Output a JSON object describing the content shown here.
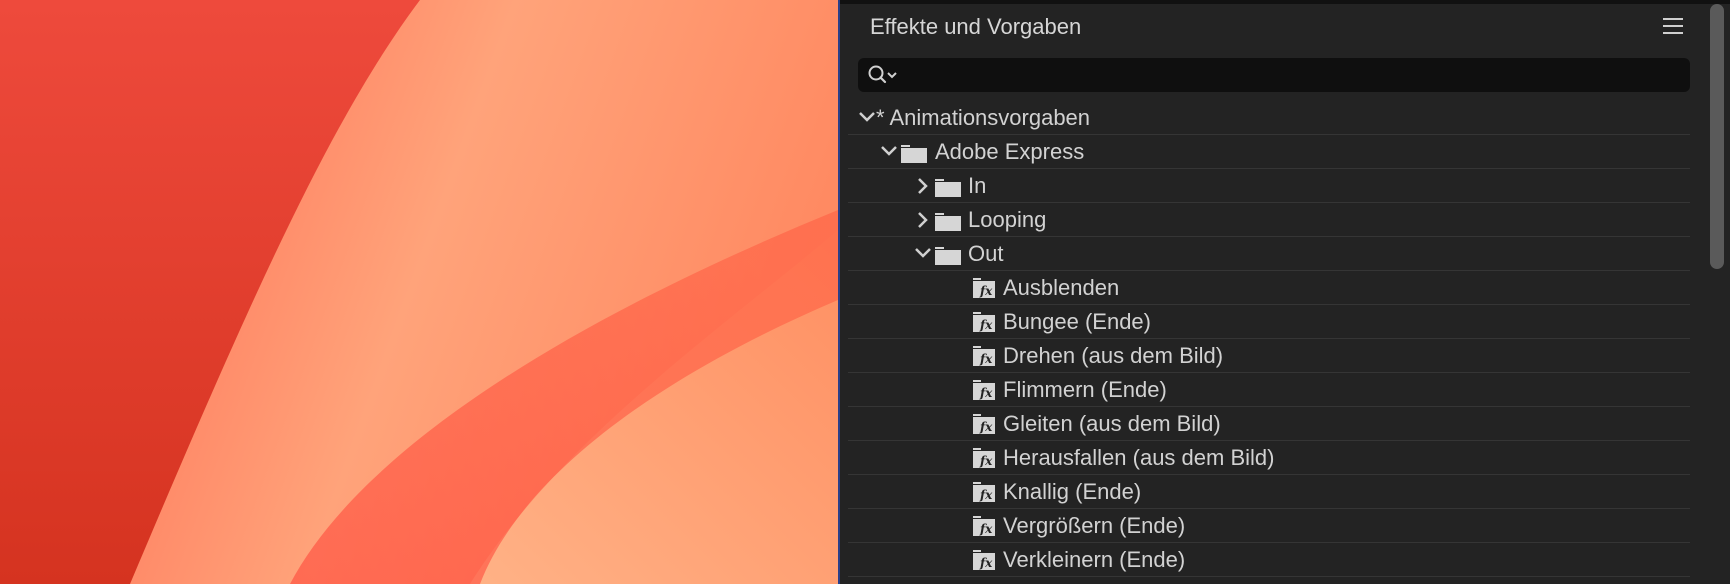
{
  "panel": {
    "title": "Effekte und Vorgaben",
    "search_placeholder": ""
  },
  "tree": {
    "root": "* Animationsvorgaben",
    "group": "Adobe Express",
    "folders": [
      "In",
      "Looping",
      "Out"
    ],
    "out_items": [
      "Ausblenden",
      "Bungee (Ende)",
      "Drehen (aus dem Bild)",
      "Flimmern (Ende)",
      "Gleiten (aus dem Bild)",
      "Herausfallen (aus dem Bild)",
      "Knallig (Ende)",
      "Vergrößern (Ende)",
      "Verkleinern (Ende)"
    ]
  },
  "icons": {
    "menu": "hamburger-icon",
    "search": "search-icon",
    "folder": "folder-icon",
    "effect": "fx-icon"
  },
  "colors": {
    "panel_bg": "#232323",
    "wallpaper_red": "#e8382e",
    "wallpaper_orange": "#ff9a6a"
  }
}
